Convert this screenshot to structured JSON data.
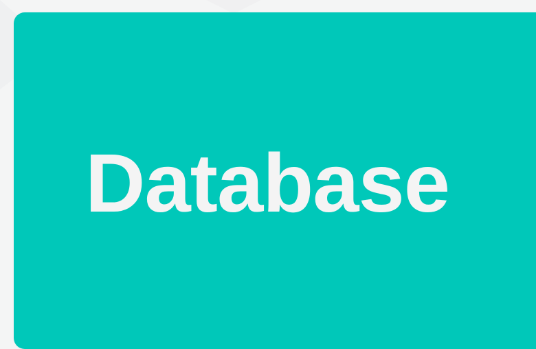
{
  "node": {
    "label": "Database"
  },
  "colors": {
    "background": "#f4f5f5",
    "node_fill": "#00c8b9",
    "label": "#f4f4f4"
  }
}
